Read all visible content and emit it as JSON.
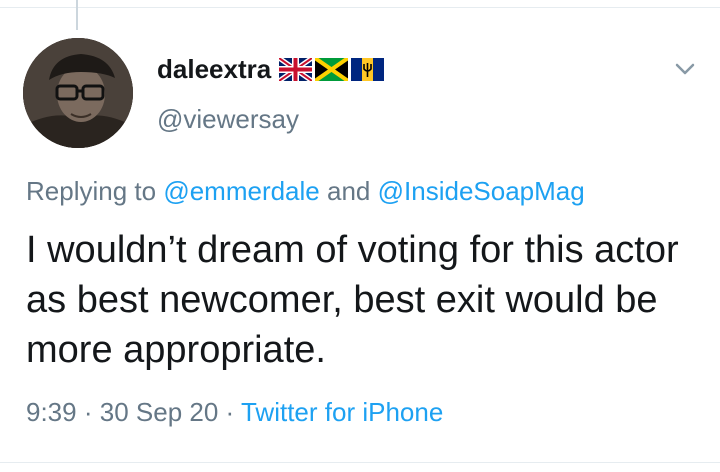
{
  "tweet": {
    "author": {
      "display_name": "daleextra",
      "handle": "@viewersay",
      "flags": [
        "united-kingdom-flag",
        "jamaica-flag",
        "barbados-flag"
      ]
    },
    "reply": {
      "prefix": "Replying to",
      "mention_1": "@emmerdale",
      "conjunction": "and",
      "mention_2": "@InsideSoapMag"
    },
    "text": "I wouldn’t dream of voting for this actor as best newcomer, best exit would be more appropriate.",
    "meta": {
      "time": "9:39",
      "separator": "·",
      "date": "30 Sep 20",
      "source": "Twitter for iPhone"
    }
  },
  "colors": {
    "text": "#14171a",
    "secondary": "#657786",
    "link": "#1da1f2",
    "divider": "#e6ecf0"
  },
  "icons": {
    "menu": "chevron-down-icon"
  }
}
